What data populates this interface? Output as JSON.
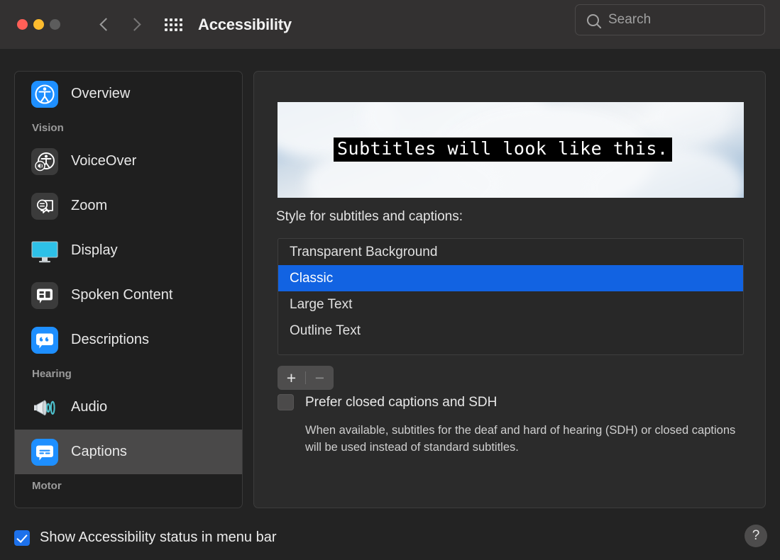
{
  "window": {
    "title": "Accessibility",
    "traffic_lights": [
      "close",
      "minimize",
      "zoom"
    ],
    "back_label": "Back",
    "forward_label": "Forward",
    "grid_label": "Show All"
  },
  "search": {
    "placeholder": "Search",
    "value": "",
    "icon": "search-icon"
  },
  "sidebar": {
    "items": [
      {
        "type": "item",
        "label": "Overview",
        "icon": "accessibility-icon",
        "selected": false
      },
      {
        "type": "group",
        "label": "Vision"
      },
      {
        "type": "item",
        "label": "VoiceOver",
        "icon": "voiceover-icon",
        "selected": false
      },
      {
        "type": "item",
        "label": "Zoom",
        "icon": "zoom-icon",
        "selected": false
      },
      {
        "type": "item",
        "label": "Display",
        "icon": "display-icon",
        "selected": false
      },
      {
        "type": "item",
        "label": "Spoken Content",
        "icon": "spoken-content-icon",
        "selected": false
      },
      {
        "type": "item",
        "label": "Descriptions",
        "icon": "descriptions-icon",
        "selected": false
      },
      {
        "type": "group",
        "label": "Hearing"
      },
      {
        "type": "item",
        "label": "Audio",
        "icon": "audio-icon",
        "selected": false
      },
      {
        "type": "item",
        "label": "Captions",
        "icon": "captions-icon",
        "selected": true
      },
      {
        "type": "group",
        "label": "Motor"
      }
    ]
  },
  "main": {
    "preview": {
      "subtitle_text": "Subtitles will look like this.",
      "background": "sky-with-clouds"
    },
    "style_label": "Style for subtitles and captions:",
    "style_list": [
      {
        "label": "Transparent Background",
        "selected": false
      },
      {
        "label": "Classic",
        "selected": true
      },
      {
        "label": "Large Text",
        "selected": false
      },
      {
        "label": "Outline Text",
        "selected": false
      }
    ],
    "add_button": "+",
    "remove_button": "−",
    "prefer_cc": {
      "label": "Prefer closed captions and SDH",
      "checked": false,
      "description": "When available, subtitles for the deaf and hard of hearing (SDH) or closed captions will be used instead of standard subtitles."
    }
  },
  "footer": {
    "menu_bar_checkbox": {
      "label": "Show Accessibility status in menu bar",
      "checked": true
    },
    "help_button": "?"
  },
  "colors": {
    "accent": "#1263e2",
    "window_bg": "#232323",
    "titlebar_bg": "#333131",
    "selection_bg": "#4a4949",
    "checkbox_on": "#1d71eb"
  }
}
